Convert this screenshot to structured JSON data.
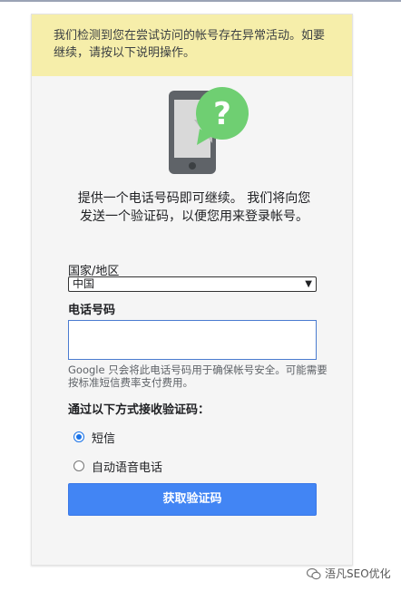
{
  "notice": {
    "text": "我们检测到您在尝试访问的帐号存在异常活动。如要继续，请按以下说明操作。"
  },
  "intro": {
    "text": "提供一个电话号码即可继续。 我们将向您发送一个验证码，以便您用来登录帐号。"
  },
  "country": {
    "label": "国家/地区",
    "selected": "中国"
  },
  "phone": {
    "label": "电话号码",
    "value": "",
    "hint": "Google 只会将此电话号码用于确保帐号安全。可能需要按标准短信费率支付费用。"
  },
  "method": {
    "label": "通过以下方式接收验证码：",
    "options": [
      {
        "label": "短信",
        "checked": true
      },
      {
        "label": "自动语音电话",
        "checked": false
      }
    ]
  },
  "submit": {
    "label": "获取验证码"
  },
  "watermark": {
    "text": "浯凡SEO优化"
  },
  "colors": {
    "notice_bg": "#f6eeaa",
    "button": "#4285f4",
    "bubble": "#6fcf72",
    "phone_body": "#5f6368"
  }
}
